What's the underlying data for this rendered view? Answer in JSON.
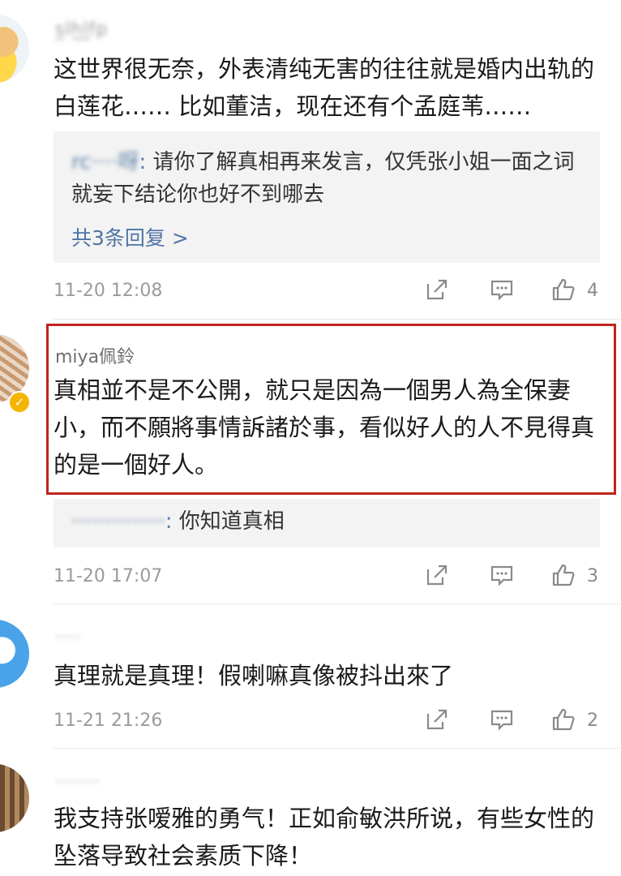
{
  "comments": [
    {
      "username": "s̲lh̲l̲fp",
      "text": "这世界很无奈，外表清纯无害的往往就是婚内出轨的白莲花…… 比如董洁，现在还有个孟庭苇……",
      "reply": {
        "name": "rc····呀",
        "sep": ":",
        "text": " 请你了解真相再来发言，仅凭张小姐一面之词就妄下结论你也好不到哪去"
      },
      "more_replies": "共3条回复 >",
      "time": "11-20 12:08",
      "likes": "4"
    },
    {
      "username": "miya佩鈴",
      "text": "真相並不是不公開，就只是因為一個男人為全保妻小，而不願將事情訴諸於事，看似好人的人不見得真的是一個好人。",
      "reply": {
        "name": "··············",
        "sep": ":",
        "text": " 你知道真相"
      },
      "time": "11-20 17:07",
      "likes": "3"
    },
    {
      "username": "····",
      "text": "真理就是真理！假喇嘛真像被抖出來了",
      "time": "11-21 21:26",
      "likes": "2"
    },
    {
      "username": "·······",
      "text": "我支持张嗳雅的勇气！正如俞敏洪所说，有些女性的坠落导致社会素质下降！"
    }
  ],
  "icons": {
    "share": "share-icon",
    "comment": "comment-icon",
    "like": "like-icon",
    "verified": "verified-badge-icon"
  },
  "colors": {
    "highlight_border": "#c0241c",
    "link": "#4f74a6",
    "verified": "#f5b400"
  }
}
